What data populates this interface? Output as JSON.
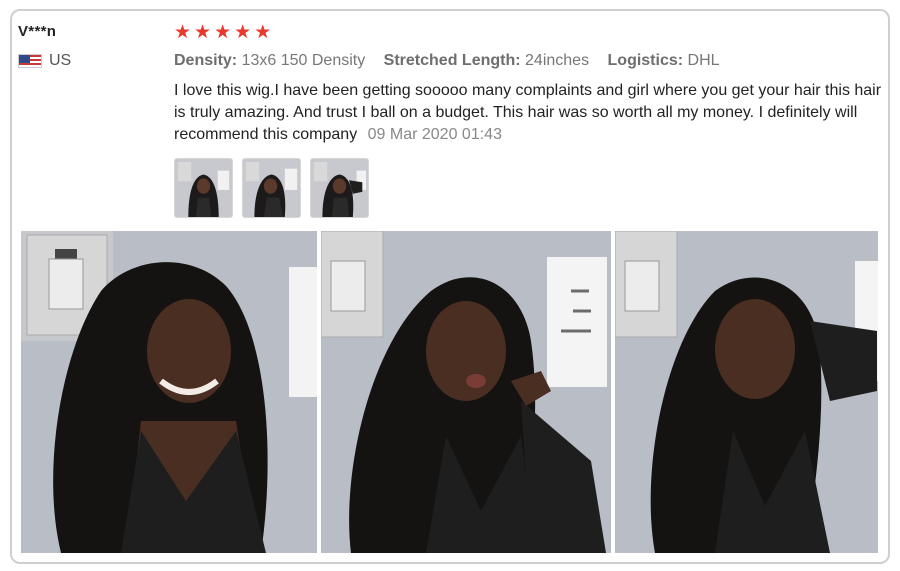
{
  "reviewer": {
    "name": "V***n",
    "country": "US",
    "flag_icon": "us-flag-icon"
  },
  "rating": {
    "stars": 5,
    "max": 5,
    "color": "#e8392e"
  },
  "specs": {
    "density_label": "Density:",
    "density_value": "13x6 150 Density",
    "length_label": "Stretched Length:",
    "length_value": "24inches",
    "logistics_label": "Logistics:",
    "logistics_value": "DHL"
  },
  "review": {
    "text": "I love this wig.I have been getting sooooo many complaints and girl where you get your hair this hair is truly amazing. And trust I ball on a budget. This hair was so worth all my money. I definitely will recommend this company",
    "date": "09 Mar 2020 01:43"
  },
  "images": {
    "thumbnails_count": 3,
    "photos_count": 3
  }
}
